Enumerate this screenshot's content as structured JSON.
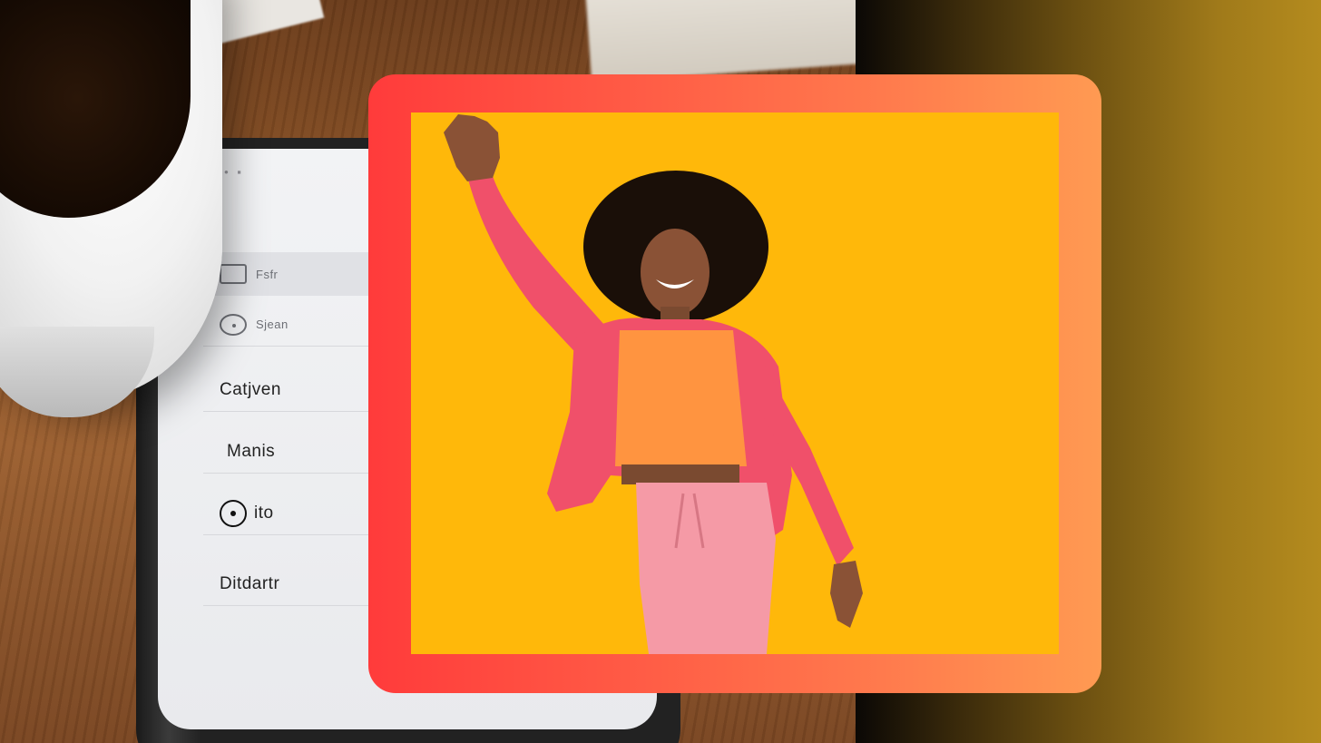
{
  "phone_menu": {
    "status": "••• ▪",
    "items": [
      {
        "label": "Fsfr",
        "icon": "square-icon"
      },
      {
        "label": "Sjean",
        "icon": "speech-bubble-icon"
      },
      {
        "label": "Catjven"
      },
      {
        "label": "Manis"
      },
      {
        "label": "ito",
        "icon": "target-icon"
      },
      {
        "label": "Ditdartr"
      }
    ]
  },
  "colors": {
    "frame_gradient_start": "#ff3b3b",
    "frame_gradient_end": "#ff9a52",
    "photo_background": "#ffb80a",
    "jacket": "#f0506a",
    "top": "#ff9440",
    "pants": "#f59aa6",
    "side_panel_dark": "#0b0805",
    "side_panel_gold": "#b48b1e"
  }
}
